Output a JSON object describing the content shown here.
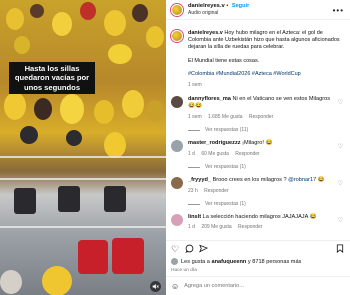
{
  "overlay_caption": "Hasta los sillas quedaron vacías por unos segundos",
  "header": {
    "username": "danielreyes.v",
    "separator": "•",
    "follow_label": "Seguir",
    "audio": "Audio original",
    "more_icon": "more-horizontal-icon"
  },
  "post": {
    "username": "danielreyes.v",
    "text": "Hoy hubo milagro en el Azteca: el gol de Colombia ante Uzbekistán hizo que hasta algunos aficionados dejaran la silla de ruedas para celebrar.",
    "text2": "El Mundial tiene estas cosas.",
    "hashtags": "#Colombia #Mundial2026 #Azteca #WorldCup",
    "time": "1 sem"
  },
  "comments": [
    {
      "user": "dannyflores_ma",
      "text": "Ni en el Vaticano se ven estos Milagros",
      "emoji": "😂😂",
      "time": "1 sem",
      "likes": "1.685 Me gusta",
      "reply": "Responder",
      "replies": "Ver respuestas (11)"
    },
    {
      "user": "master_rodriguezzz",
      "text": "¡Milagro!",
      "emoji": "😂",
      "time": "1 d",
      "likes": "60 Me gusta",
      "reply": "Responder",
      "replies": "Ver respuestas (1)"
    },
    {
      "user": "_fryyyd_",
      "text": "Brooo crees en los milagros ?",
      "mention": "@robnar17",
      "emoji": "😂",
      "time": "23 h",
      "likes": "",
      "reply": "Responder",
      "replies": "Ver respuestas (1)"
    },
    {
      "user": "linslt",
      "text": "La selección haciendo milagros JAJAJAJA",
      "emoji": "😂",
      "time": "1 d",
      "likes": "209 Me gusta",
      "reply": "Responder",
      "replies": ""
    }
  ],
  "actions": {
    "liked_by": "Les gusta a",
    "liked_user": "anafuqueenn",
    "liked_rest": "y 8718 personas más",
    "date": "Hace un día"
  },
  "add_comment": {
    "placeholder": "Agrega un comentario..."
  },
  "colors": {
    "accent_blue": "#0095f6",
    "link_dark": "#00376b",
    "muted": "#737373"
  }
}
